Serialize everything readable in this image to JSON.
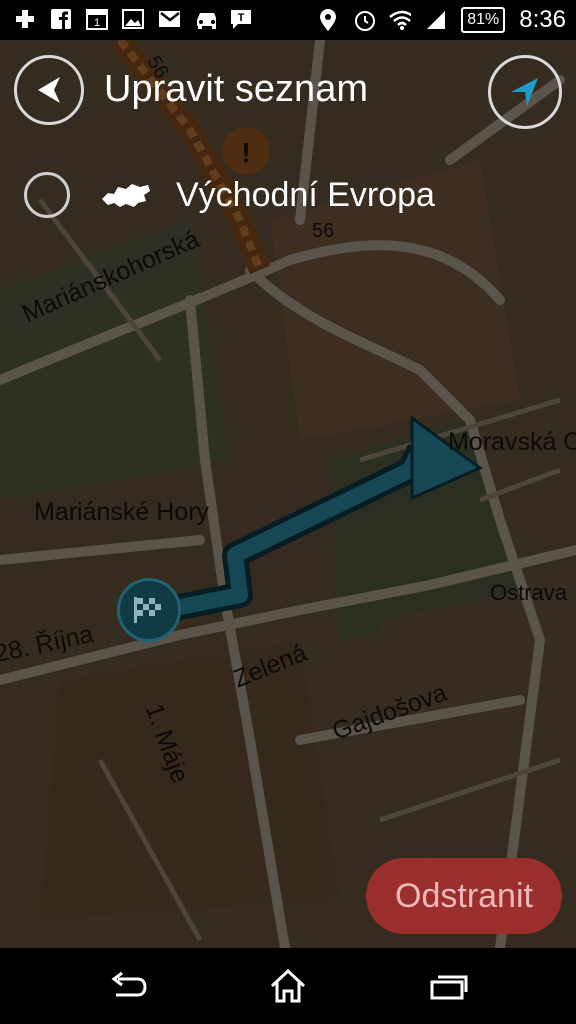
{
  "status": {
    "battery": "81%",
    "time": "8:36",
    "icons": [
      "add-icon",
      "facebook-icon",
      "calendar-icon",
      "gallery-icon",
      "gmail-icon",
      "car-icon",
      "message-icon",
      "location-pin-icon",
      "alarm-icon",
      "wifi-icon",
      "signal-icon"
    ],
    "calendar_day": "1",
    "message_letter": "T"
  },
  "header": {
    "title": "Upravit seznam"
  },
  "list": {
    "items": [
      {
        "label": "Východní Evropa",
        "icon": "europe-map-icon",
        "checked": false
      }
    ]
  },
  "map": {
    "streets": [
      "Mariánskohorská",
      "Mariánské Hory",
      "Moravská O",
      "Ostrava",
      "28. Října",
      "Zelená",
      "1. Máje",
      "Gajdošova"
    ],
    "road_numbers": [
      "56",
      "56"
    ],
    "route_color": "#1e6f87"
  },
  "actions": {
    "delete_label": "Odstranit"
  },
  "system_nav": {
    "icons": [
      "back-arrow-icon",
      "home-icon",
      "recent-apps-icon"
    ]
  }
}
